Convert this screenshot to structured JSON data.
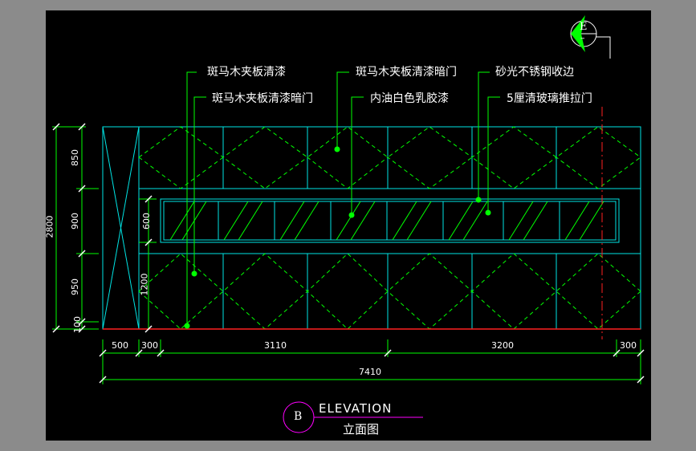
{
  "colors": {
    "background": "#000000",
    "frame": "#8b8b8b",
    "cyan": "#00e5e5",
    "green": "#00ff00",
    "red": "#ff2020",
    "magenta": "#ff00ff",
    "white": "#ffffff"
  },
  "callouts": [
    "斑马木夹板清漆",
    "斑马木夹板清漆暗门",
    "斑马木夹板清漆暗门",
    "内油白色乳胶漆",
    "砂光不锈钢收边",
    "5厘清玻璃推拉门"
  ],
  "dims_vertical": {
    "total": "2800",
    "d1": "850",
    "d2": "900",
    "d3": "950",
    "d4": "100",
    "inner1": "600",
    "inner2": "1200"
  },
  "dims_horizontal": {
    "h1": "500",
    "h2": "300",
    "h3": "3110",
    "h4": "3200",
    "h5": "300",
    "total": "7410"
  },
  "title_block": {
    "marker": "B",
    "title": "ELEVATION",
    "subtitle": "立面图"
  },
  "section_marker": {
    "letter": "E",
    "sub": "–"
  }
}
